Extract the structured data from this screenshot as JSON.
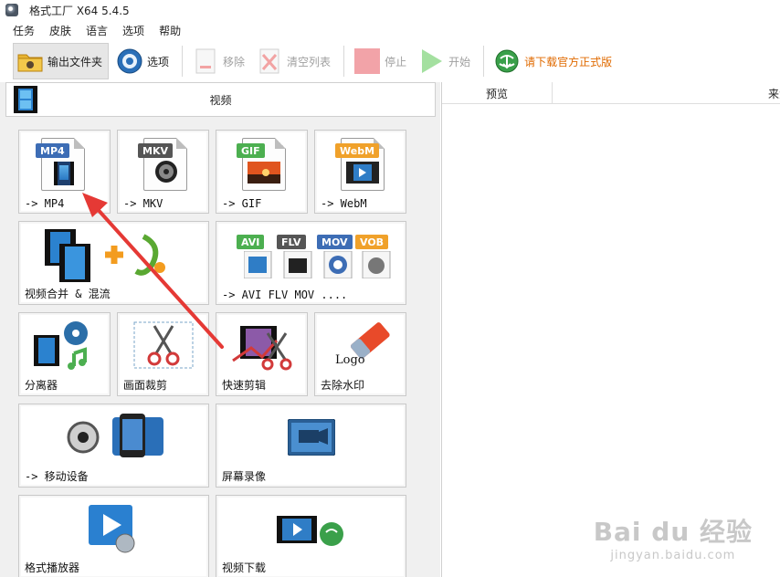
{
  "window": {
    "title": "格式工厂 X64 5.4.5"
  },
  "menu": {
    "items": [
      "任务",
      "皮肤",
      "语言",
      "选项",
      "帮助"
    ]
  },
  "toolbar": {
    "output_folder": "输出文件夹",
    "options": "选项",
    "remove": "移除",
    "clear_list": "清空列表",
    "stop": "停止",
    "start": "开始",
    "download": "请下载官方正式版"
  },
  "category": {
    "label": "视频"
  },
  "tiles": {
    "mp4": {
      "label": "-> MP4",
      "badge": "MP4"
    },
    "mkv": {
      "label": "-> MKV",
      "badge": "MKV"
    },
    "gif": {
      "label": "-> GIF",
      "badge": "GIF"
    },
    "webm": {
      "label": "-> WebM",
      "badge": "WebM"
    },
    "merge": {
      "label": "视频合并 & 混流"
    },
    "multi": {
      "label": "-> AVI FLV MOV ....",
      "badges": [
        "AVI",
        "FLV",
        "MOV",
        "VOB"
      ]
    },
    "splitter": {
      "label": "分离器"
    },
    "crop": {
      "label": "画面裁剪"
    },
    "quickcut": {
      "label": "快速剪辑"
    },
    "watermark": {
      "label": "去除水印",
      "logo_text": "Logo"
    },
    "mobile": {
      "label": "-> 移动设备"
    },
    "screenrec": {
      "label": "屏幕录像"
    },
    "player": {
      "label": "格式播放器"
    },
    "download": {
      "label": "视频下载"
    }
  },
  "list": {
    "col_preview": "预览",
    "col_source": "来源"
  },
  "watermark": {
    "main": "Bai du 经验",
    "sub": "jingyan.baidu.com"
  },
  "colors": {
    "accent_arrow": "#e53935",
    "download_text": "#e06a00",
    "tile_border": "#c9c9c9"
  }
}
